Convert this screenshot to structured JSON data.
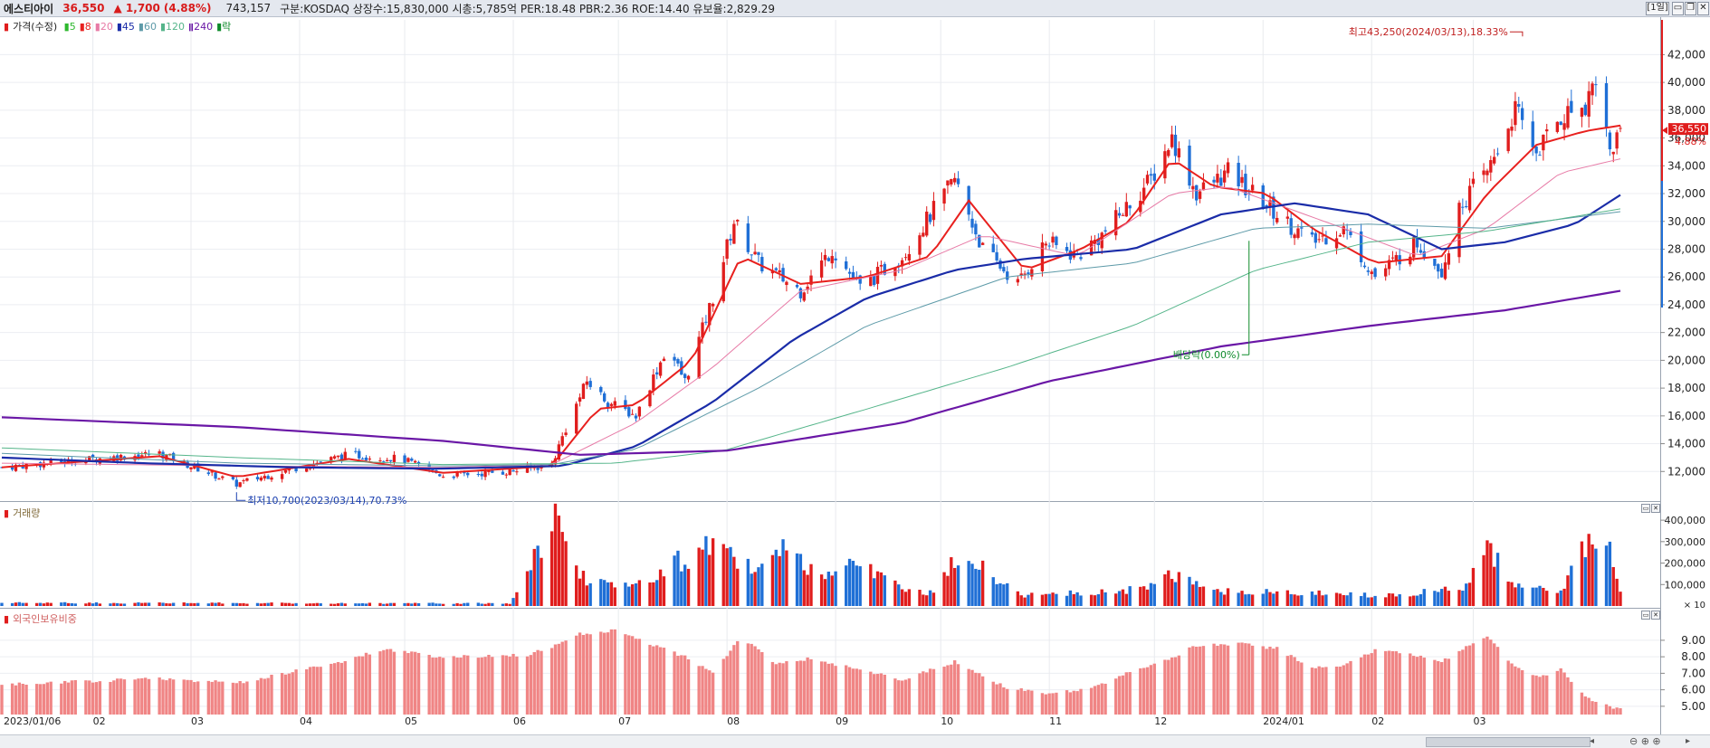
{
  "header": {
    "name": "에스티아이",
    "price": "36,550",
    "change": "▲ 1,700",
    "change_pct": "(4.88%)",
    "volume": "743,157",
    "info": "구분:KOSDAQ 상장수:15,830,000 시총:5,785억 PER:18.48 PBR:2.36 ROE:14.40 유보율:2,829.29",
    "period_button": "[1일]"
  },
  "legend": {
    "price_label": "가격(수정)",
    "ma": [
      {
        "label": "5",
        "color": "#2db82d"
      },
      {
        "label": "8",
        "color": "#e8201e"
      },
      {
        "label": "20",
        "color": "#e77aa6"
      },
      {
        "label": "45",
        "color": "#1a2ca8"
      },
      {
        "label": "60",
        "color": "#5d9aa8"
      },
      {
        "label": "120",
        "color": "#55b58a"
      },
      {
        "label": "240",
        "color": "#6a17a6"
      },
      {
        "label": "락",
        "color": "#0d8a2a"
      }
    ]
  },
  "volume_panel": {
    "title": "거래량"
  },
  "foreign_panel": {
    "title": "외국인보유비중"
  },
  "colors": {
    "up": "#e01d1d",
    "down": "#1f6fd6",
    "fb": "#f08585"
  },
  "annotations": {
    "high": "최고43,250(2024/03/13),18.33%",
    "low": "최저10,700(2023/03/14),70.73%",
    "dividend": "배당락(0.00%)",
    "price_tag": "36,550",
    "pct_tag": "4.88%"
  },
  "chart_data": {
    "type": "candlestick",
    "x_labels": [
      "2023/01/06",
      "02",
      "03",
      "04",
      "05",
      "06",
      "07",
      "08",
      "09",
      "10",
      "11",
      "12",
      "2024/01",
      "02",
      "03"
    ],
    "x_label_dates": [
      "2023/01/06",
      "2023/02",
      "2023/03",
      "2023/04",
      "2023/05",
      "2023/06",
      "2023/07",
      "2023/08",
      "2023/09",
      "2023/10",
      "2023/11",
      "2023/12",
      "2024/01",
      "2024/02",
      "2024/03"
    ],
    "price_axis": {
      "ticks": [
        12000,
        14000,
        16000,
        18000,
        20000,
        22000,
        24000,
        26000,
        28000,
        30000,
        32000,
        34000,
        36000,
        38000,
        40000,
        42000
      ],
      "ylim": [
        10000,
        44500
      ]
    },
    "volume_axis": {
      "ticks": [
        100000,
        200000,
        300000,
        400000
      ],
      "unit": "× 10",
      "ylim": [
        0,
        430000
      ]
    },
    "foreign_axis": {
      "ticks": [
        5.0,
        6.0,
        7.0,
        8.0,
        9.0
      ],
      "ylim": [
        4.5,
        10.2
      ]
    },
    "close_keypoints": [
      [
        "2023/01/06",
        12300
      ],
      [
        "2023/02/01",
        12900
      ],
      [
        "2023/02/20",
        13300
      ],
      [
        "2023/03/14",
        11100
      ],
      [
        "2023/03/30",
        12200
      ],
      [
        "2023/04/15",
        13200
      ],
      [
        "2023/04/30",
        12900
      ],
      [
        "2023/05/12",
        11700
      ],
      [
        "2023/05/31",
        12000
      ],
      [
        "2023/06/12",
        12500
      ],
      [
        "2023/06/15",
        14500
      ],
      [
        "2023/06/22",
        18500
      ],
      [
        "2023/06/28",
        17000
      ],
      [
        "2023/07/06",
        16000
      ],
      [
        "2023/07/15",
        21000
      ],
      [
        "2023/07/20",
        18500
      ],
      [
        "2023/07/28",
        24500
      ],
      [
        "2023/08/03",
        30000
      ],
      [
        "2023/08/10",
        27000
      ],
      [
        "2023/08/22",
        25000
      ],
      [
        "2023/08/31",
        28000
      ],
      [
        "2023/09/08",
        25200
      ],
      [
        "2023/09/20",
        27500
      ],
      [
        "2023/10/05",
        33000
      ],
      [
        "2023/10/13",
        28000
      ],
      [
        "2023/10/23",
        25500
      ],
      [
        "2023/10/31",
        28500
      ],
      [
        "2023/11/09",
        27500
      ],
      [
        "2023/11/16",
        29000
      ],
      [
        "2023/11/30",
        33000
      ],
      [
        "2023/12/06",
        36000
      ],
      [
        "2023/12/13",
        32000
      ],
      [
        "2023/12/22",
        33500
      ],
      [
        "2024/01/05",
        30500
      ],
      [
        "2024/01/15",
        28500
      ],
      [
        "2024/01/24",
        29500
      ],
      [
        "2024/02/02",
        26000
      ],
      [
        "2024/02/14",
        28500
      ],
      [
        "2024/02/21",
        26500
      ],
      [
        "2024/02/27",
        31500
      ],
      [
        "2024/03/05",
        33500
      ],
      [
        "2024/03/13",
        38000
      ],
      [
        "2024/03/19",
        35000
      ],
      [
        "2024/03/26",
        37500
      ],
      [
        "2024/04/02",
        38500
      ],
      [
        "2024/04/05",
        40500
      ],
      [
        "2024/04/09",
        35000
      ],
      [
        "2024/04/12",
        36550
      ]
    ],
    "ma_lines": {
      "ma8": [
        [
          "2023/01/06",
          12300
        ],
        [
          "2023/02/20",
          13100
        ],
        [
          "2023/03/14",
          11600
        ],
        [
          "2023/04/15",
          12900
        ],
        [
          "2023/05/12",
          11900
        ],
        [
          "2023/06/12",
          12400
        ],
        [
          "2023/06/25",
          16500
        ],
        [
          "2023/07/06",
          16800
        ],
        [
          "2023/07/22",
          20000
        ],
        [
          "2023/08/05",
          27500
        ],
        [
          "2023/08/22",
          25500
        ],
        [
          "2023/09/10",
          26000
        ],
        [
          "2023/09/28",
          27500
        ],
        [
          "2023/10/09",
          31500
        ],
        [
          "2023/10/25",
          26500
        ],
        [
          "2023/11/10",
          28000
        ],
        [
          "2023/11/24",
          30000
        ],
        [
          "2023/12/06",
          34500
        ],
        [
          "2023/12/18",
          32500
        ],
        [
          "2024/01/02",
          32000
        ],
        [
          "2024/01/15",
          29500
        ],
        [
          "2024/02/02",
          27000
        ],
        [
          "2024/02/21",
          27500
        ],
        [
          "2024/03/05",
          32000
        ],
        [
          "2024/03/19",
          35500
        ],
        [
          "2024/04/02",
          36500
        ],
        [
          "2024/04/12",
          36900
        ]
      ],
      "ma20": [
        [
          "2023/01/06",
          12600
        ],
        [
          "2023/03/14",
          12400
        ],
        [
          "2023/05/12",
          12300
        ],
        [
          "2023/06/12",
          12500
        ],
        [
          "2023/07/06",
          15500
        ],
        [
          "2023/07/28",
          19500
        ],
        [
          "2023/08/22",
          25000
        ],
        [
          "2023/09/20",
          26500
        ],
        [
          "2023/10/13",
          29000
        ],
        [
          "2023/11/09",
          27500
        ],
        [
          "2023/12/06",
          32000
        ],
        [
          "2023/12/22",
          32500
        ],
        [
          "2024/01/24",
          29500
        ],
        [
          "2024/02/14",
          27500
        ],
        [
          "2024/03/05",
          29500
        ],
        [
          "2024/03/26",
          33500
        ],
        [
          "2024/04/12",
          34500
        ]
      ],
      "ma45": [
        [
          "2023/01/06",
          13000
        ],
        [
          "2023/02/15",
          12600
        ],
        [
          "2023/03/30",
          12300
        ],
        [
          "2023/05/10",
          12200
        ],
        [
          "2023/06/15",
          12400
        ],
        [
          "2023/07/06",
          13800
        ],
        [
          "2023/07/28",
          17000
        ],
        [
          "2023/08/20",
          21500
        ],
        [
          "2023/09/10",
          24500
        ],
        [
          "2023/10/05",
          26500
        ],
        [
          "2023/10/25",
          27300
        ],
        [
          "2023/11/25",
          28000
        ],
        [
          "2023/12/20",
          30500
        ],
        [
          "2024/01/10",
          31300
        ],
        [
          "2024/01/31",
          30500
        ],
        [
          "2024/02/21",
          28000
        ],
        [
          "2024/03/10",
          28500
        ],
        [
          "2024/03/30",
          29800
        ],
        [
          "2024/04/12",
          31900
        ]
      ],
      "ma60": [
        [
          "2023/01/06",
          13300
        ],
        [
          "2023/03/14",
          12600
        ],
        [
          "2023/05/12",
          12400
        ],
        [
          "2023/06/12",
          12500
        ],
        [
          "2023/07/06",
          13600
        ],
        [
          "2023/08/10",
          18000
        ],
        [
          "2023/09/10",
          22500
        ],
        [
          "2023/10/20",
          26000
        ],
        [
          "2023/11/25",
          27000
        ],
        [
          "2023/12/30",
          29500
        ],
        [
          "2024/01/31",
          29800
        ],
        [
          "2024/03/05",
          29500
        ],
        [
          "2024/04/12",
          30700
        ]
      ],
      "ma120": [
        [
          "2023/01/06",
          13700
        ],
        [
          "2023/03/14",
          13000
        ],
        [
          "2023/05/12",
          12500
        ],
        [
          "2023/06/30",
          12600
        ],
        [
          "2023/07/31",
          13500
        ],
        [
          "2023/09/10",
          16500
        ],
        [
          "2023/10/20",
          19500
        ],
        [
          "2023/11/25",
          22500
        ],
        [
          "2023/12/30",
          26500
        ],
        [
          "2024/01/31",
          28500
        ],
        [
          "2024/03/05",
          29300
        ],
        [
          "2024/04/12",
          30900
        ]
      ],
      "ma240": [
        [
          "2023/01/06",
          15900
        ],
        [
          "2023/03/14",
          15200
        ],
        [
          "2023/05/12",
          14200
        ],
        [
          "2023/06/20",
          13200
        ],
        [
          "2023/08/01",
          13500
        ],
        [
          "2023/09/20",
          15500
        ],
        [
          "2023/11/01",
          18500
        ],
        [
          "2023/12/20",
          21000
        ],
        [
          "2024/02/01",
          22500
        ],
        [
          "2024/03/10",
          23600
        ],
        [
          "2024/04/12",
          25000
        ]
      ]
    },
    "volume_keypoints": [
      [
        "2023/01/06",
        15000
      ],
      [
        "2023/05/31",
        12000
      ],
      [
        "2023/06/13",
        420000
      ],
      [
        "2023/06/16",
        260000
      ],
      [
        "2023/06/22",
        120000
      ],
      [
        "2023/07/10",
        100000
      ],
      [
        "2023/07/17",
        200000
      ],
      [
        "2023/07/28",
        280000
      ],
      [
        "2023/08/10",
        150000
      ],
      [
        "2023/08/17",
        260000
      ],
      [
        "2023/08/28",
        120000
      ],
      [
        "2023/09/08",
        200000
      ],
      [
        "2023/09/18",
        100000
      ],
      [
        "2023/09/28",
        60000
      ],
      [
        "2023/10/05",
        210000
      ],
      [
        "2023/10/13",
        170000
      ],
      [
        "2023/10/25",
        50000
      ],
      [
        "2023/11/10",
        60000
      ],
      [
        "2023/11/29",
        80000
      ],
      [
        "2023/12/06",
        150000
      ],
      [
        "2023/12/20",
        70000
      ],
      [
        "2024/01/15",
        60000
      ],
      [
        "2024/02/05",
        50000
      ],
      [
        "2024/02/27",
        80000
      ],
      [
        "2024/03/05",
        300000
      ],
      [
        "2024/03/11",
        100000
      ],
      [
        "2024/03/26",
        60000
      ],
      [
        "2024/04/02",
        280000
      ],
      [
        "2024/04/05",
        290000
      ],
      [
        "2024/04/09",
        240000
      ],
      [
        "2024/04/12",
        70000
      ]
    ],
    "foreign_keypoints": [
      [
        "2023/01/06",
        6.3
      ],
      [
        "2023/02/20",
        6.7
      ],
      [
        "2023/03/14",
        6.4
      ],
      [
        "2023/04/15",
        7.8
      ],
      [
        "2023/04/25",
        8.5
      ],
      [
        "2023/05/10",
        8.0
      ],
      [
        "2023/06/05",
        8.1
      ],
      [
        "2023/06/12",
        8.6
      ],
      [
        "2023/06/20",
        9.4
      ],
      [
        "2023/07/01",
        9.6
      ],
      [
        "2023/07/10",
        8.8
      ],
      [
        "2023/07/20",
        8.0
      ],
      [
        "2023/07/28",
        7.0
      ],
      [
        "2023/08/05",
        9.2
      ],
      [
        "2023/08/15",
        7.6
      ],
      [
        "2023/08/25",
        7.9
      ],
      [
        "2023/09/08",
        7.2
      ],
      [
        "2023/09/20",
        6.6
      ],
      [
        "2023/10/05",
        7.7
      ],
      [
        "2023/10/20",
        6.1
      ],
      [
        "2023/10/31",
        5.8
      ],
      [
        "2023/11/12",
        6.0
      ],
      [
        "2023/11/25",
        7.2
      ],
      [
        "2023/12/06",
        7.9
      ],
      [
        "2023/12/13",
        8.7
      ],
      [
        "2023/12/25",
        8.8
      ],
      [
        "2024/01/05",
        8.5
      ],
      [
        "2024/01/15",
        7.3
      ],
      [
        "2024/01/24",
        7.5
      ],
      [
        "2024/02/02",
        8.4
      ],
      [
        "2024/02/14",
        8.1
      ],
      [
        "2024/02/21",
        7.7
      ],
      [
        "2024/02/27",
        8.5
      ],
      [
        "2024/03/05",
        9.3
      ],
      [
        "2024/03/12",
        7.5
      ],
      [
        "2024/03/20",
        6.8
      ],
      [
        "2024/03/26",
        7.2
      ],
      [
        "2024/04/02",
        5.6
      ],
      [
        "2024/04/05",
        5.3
      ],
      [
        "2024/04/09",
        5.0
      ],
      [
        "2024/04/12",
        4.8
      ]
    ]
  }
}
